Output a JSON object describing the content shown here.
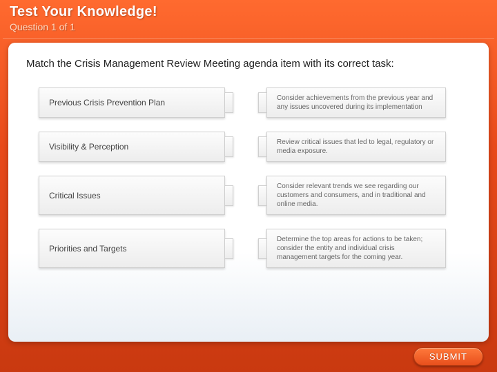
{
  "header": {
    "title": "Test Your Knowledge!",
    "subtitle": "Question 1 of 1"
  },
  "question": "Match the Crisis Management Review Meeting agenda item with its correct task:",
  "rows": [
    {
      "left": "Previous Crisis Prevention Plan",
      "right": "Consider achievements from the previous year and any issues uncovered during its implementation"
    },
    {
      "left": "Visibility & Perception",
      "right": "Review critical issues that led to legal, regulatory or media exposure."
    },
    {
      "left": "Critical Issues",
      "right": "Consider relevant trends we see regarding our customers and consumers, and in traditional and online media."
    },
    {
      "left": "Priorities and Targets",
      "right": "Determine the top areas for actions to be taken; consider the entity and individual crisis management targets for the coming year."
    }
  ],
  "footer": {
    "submit_label": "SUBMIT"
  }
}
